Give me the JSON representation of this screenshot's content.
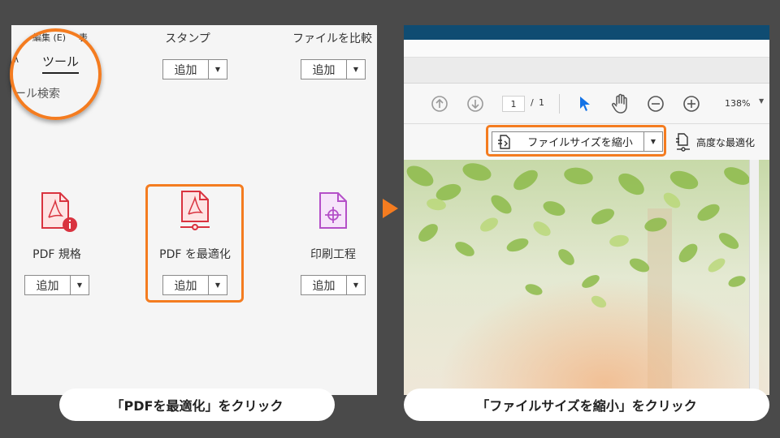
{
  "left_panel": {
    "menu_edit": "編集 (E)",
    "menu_edit_extra": "表",
    "tab_tools": "ツール",
    "tool_search": "ール検索",
    "tool_caret": "∧",
    "tools": [
      {
        "label": "スタンプ",
        "add": "追加"
      },
      {
        "label": "ファイルを比較",
        "add": "追加"
      },
      {
        "label": "PDF 規格",
        "add": "追加"
      },
      {
        "label": "PDF を最適化",
        "add": "追加"
      },
      {
        "label": "印刷工程",
        "add": "追加"
      }
    ],
    "dropdown_glyph": "▼"
  },
  "right_panel": {
    "page_current": "1",
    "page_sep": "/",
    "page_total": "1",
    "zoom": "138%",
    "zoom_caret": "▼",
    "reduce_label": "ファイルサイズを縮小",
    "reduce_caret": "▼",
    "advanced_label": "高度な最適化"
  },
  "captions": {
    "left": "「PDFを最適化」をクリック",
    "right": "「ファイルサイズを縮小」をクリック"
  },
  "colors": {
    "highlight": "#f47c20",
    "background": "#4a4a4a",
    "pdf_red": "#d9333f",
    "print_purple": "#b44fc8",
    "title_blue": "#0f4c72",
    "select_blue": "#1473e6"
  },
  "icons": [
    "pdf-standards-icon",
    "optimize-pdf-icon",
    "print-production-icon",
    "page-up-icon",
    "page-down-icon",
    "select-arrow-icon",
    "hand-icon",
    "zoom-out-icon",
    "zoom-in-icon",
    "reduce-file-size-icon",
    "advanced-optimization-icon"
  ]
}
